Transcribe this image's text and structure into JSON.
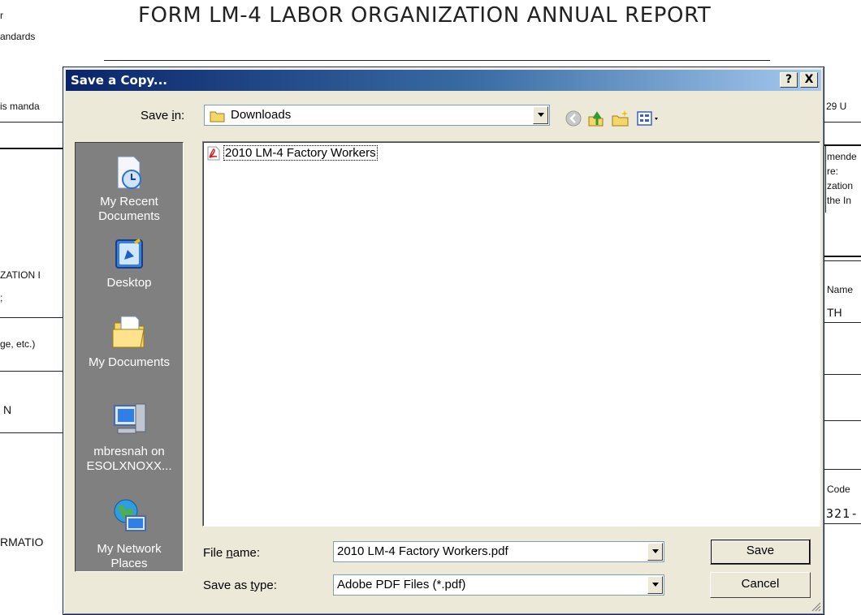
{
  "background": {
    "title": "FORM LM-4 LABOR ORGANIZATION ANNUAL REPORT",
    "left_fragments": [
      "r",
      "andards",
      "is manda",
      "ZATION I",
      ";",
      "ge, etc.)",
      "N",
      "RMATIO"
    ],
    "right_fragments": [
      "29 U",
      "mende",
      "re:",
      "zation",
      "the In",
      "Name",
      "TH",
      "Code",
      "321-"
    ]
  },
  "dialog": {
    "title": "Save a Copy...",
    "help_button": "?",
    "close_button": "X",
    "save_in_label_pre": "Save ",
    "save_in_label_u": "i",
    "save_in_label_post": "n:",
    "save_in_value": "Downloads",
    "places": [
      {
        "label1": "My Recent",
        "label2": "Documents"
      },
      {
        "label1": "Desktop",
        "label2": ""
      },
      {
        "label1": "My Documents",
        "label2": ""
      },
      {
        "label1": "mbresnah on",
        "label2": "ESOLXNOXX..."
      },
      {
        "label1": "My Network",
        "label2": "Places"
      }
    ],
    "files": [
      {
        "name": "2010 LM-4 Factory Workers"
      }
    ],
    "file_name_label_pre": "File ",
    "file_name_label_u": "n",
    "file_name_label_post": "ame:",
    "file_name_value": "2010 LM-4 Factory Workers.pdf",
    "save_type_label_pre": "Save as ",
    "save_type_label_u": "t",
    "save_type_label_post": "ype:",
    "save_type_value": "Adobe PDF Files (*.pdf)",
    "save_button": "Save",
    "cancel_button": "Cancel"
  }
}
